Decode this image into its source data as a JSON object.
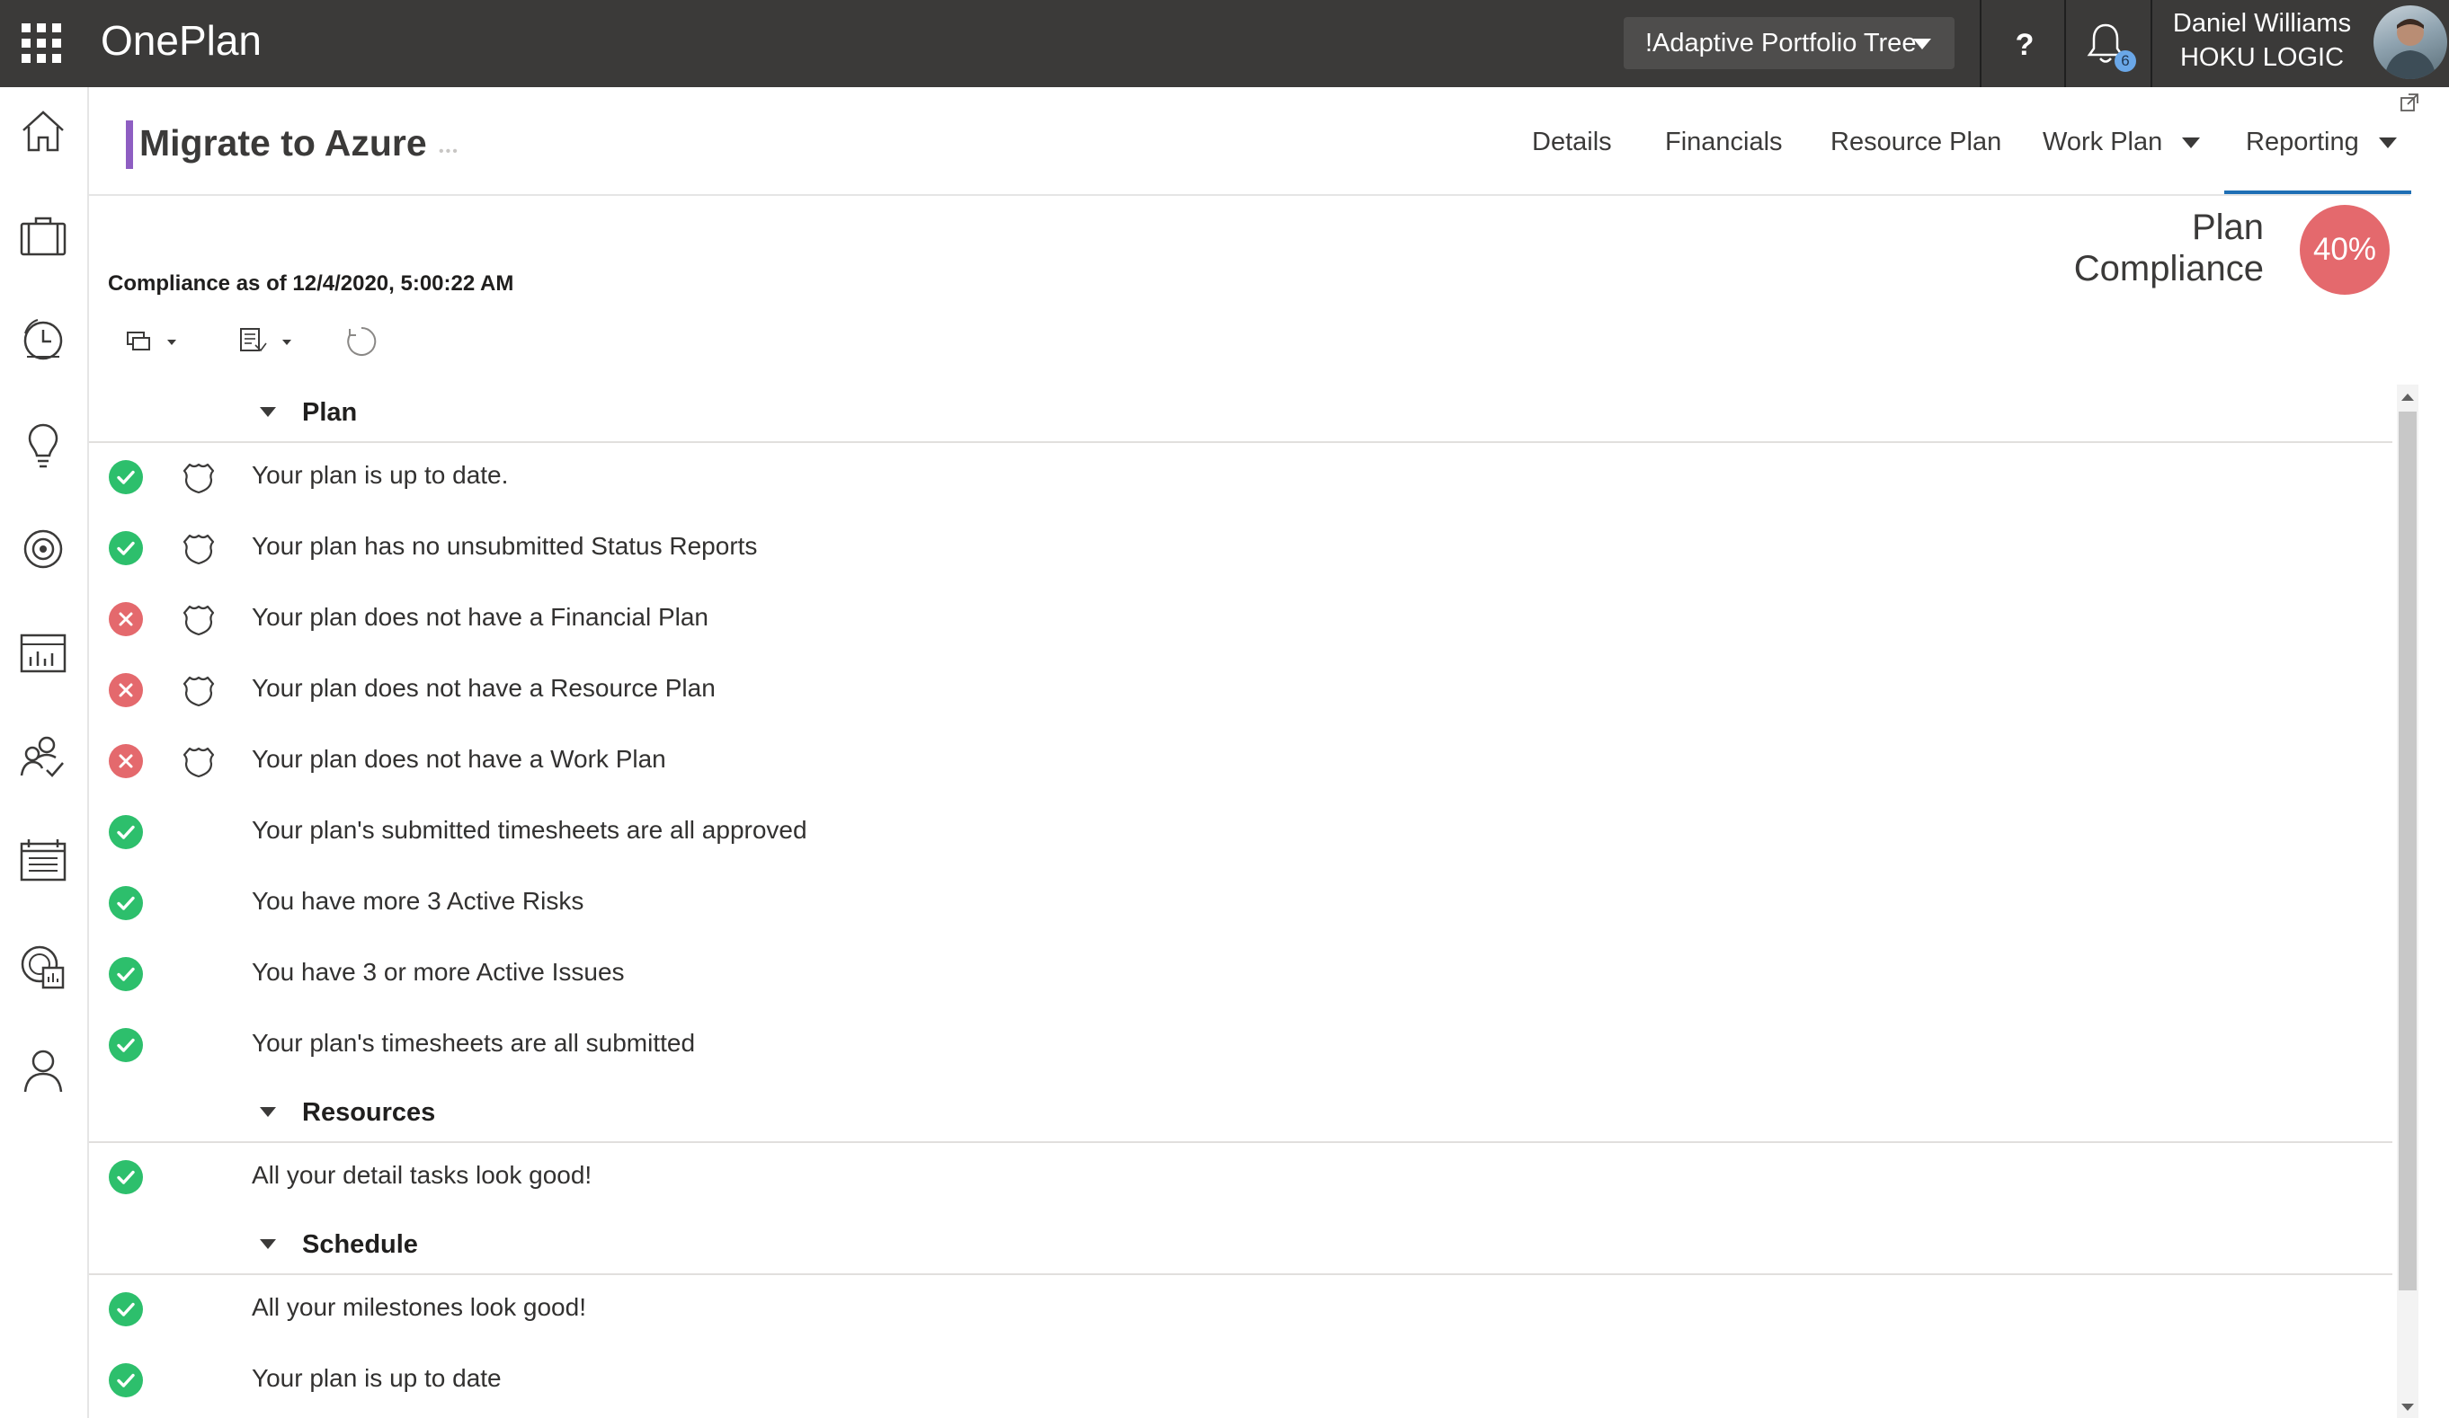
{
  "app": {
    "brand": "OnePlan"
  },
  "topbar": {
    "portfolio_label": "!Adaptive Portfolio Tree",
    "help_label": "?",
    "notifications_count": "6",
    "user_name": "Daniel Williams",
    "user_org": "HOKU LOGIC"
  },
  "rail": {
    "icons": [
      "home-icon",
      "briefcase-icon",
      "timesheet-clock-icon",
      "lightbulb-icon",
      "target-icon",
      "chart-board-icon",
      "people-check-icon",
      "calendar-board-icon",
      "analytics-report-icon",
      "person-icon"
    ]
  },
  "page": {
    "title": "Migrate to Azure",
    "title_more": "•••",
    "title_accent_color": "#8e5ec2",
    "nav": {
      "details": "Details",
      "financials": "Financials",
      "resource_plan": "Resource Plan",
      "work_plan": "Work Plan",
      "reporting": "Reporting"
    },
    "active_tab": "Reporting",
    "compliance_label_line1": "Plan",
    "compliance_label_line2": "Compliance",
    "compliance_pct": "40%",
    "compliance_color": "#e4696d",
    "as_of": "Compliance as of 12/4/2020, 5:00:22 AM"
  },
  "colors": {
    "pass": "#2dbf6c",
    "fail": "#e4696d",
    "accent": "#1f6fb5"
  },
  "groups": {
    "plan": {
      "label": "Plan",
      "items": [
        {
          "text": "Your plan is up to date.",
          "status": "pass",
          "shield": true
        },
        {
          "text": "Your plan has no unsubmitted Status Reports",
          "status": "pass",
          "shield": true
        },
        {
          "text": "Your plan does not have a Financial Plan",
          "status": "fail",
          "shield": true
        },
        {
          "text": "Your plan does not have a Resource Plan",
          "status": "fail",
          "shield": true
        },
        {
          "text": "Your plan does not have a Work Plan",
          "status": "fail",
          "shield": true
        },
        {
          "text": "Your plan's submitted timesheets are all approved",
          "status": "pass",
          "shield": false
        },
        {
          "text": "You have more 3 Active Risks",
          "status": "pass",
          "shield": false
        },
        {
          "text": "You have 3 or more Active Issues",
          "status": "pass",
          "shield": false
        },
        {
          "text": "Your plan's timesheets are all submitted",
          "status": "pass",
          "shield": false
        }
      ]
    },
    "resources": {
      "label": "Resources",
      "items": [
        {
          "text": "All your detail tasks look good!",
          "status": "pass",
          "shield": false
        }
      ]
    },
    "schedule": {
      "label": "Schedule",
      "items": [
        {
          "text": "All your milestones look good!",
          "status": "pass",
          "shield": false
        },
        {
          "text": "Your plan is up to date",
          "status": "pass",
          "shield": false
        }
      ]
    }
  }
}
